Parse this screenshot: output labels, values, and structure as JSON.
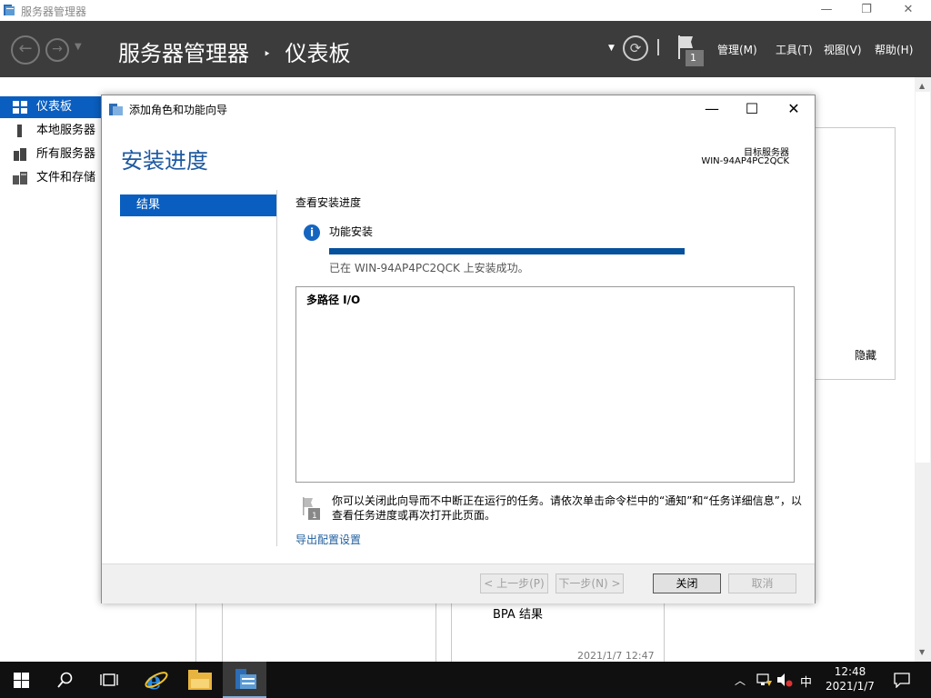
{
  "window": {
    "title": "服务器管理器",
    "minimize": "—",
    "restore": "❐",
    "close": "✕"
  },
  "header": {
    "breadcrumb_app": "服务器管理器",
    "breadcrumb_sep": "‣",
    "breadcrumb_page": "仪表板",
    "notification_count": "1",
    "menus": [
      "管理(M)",
      "工具(T)",
      "视图(V)",
      "帮助(H)"
    ]
  },
  "sidebar": {
    "items": [
      {
        "label": "仪表板",
        "icon": "dashboard-icon",
        "selected": true
      },
      {
        "label": "本地服务器",
        "icon": "server-icon",
        "selected": false
      },
      {
        "label": "所有服务器",
        "icon": "servers-icon",
        "selected": false
      },
      {
        "label": "文件和存储",
        "icon": "storage-icon",
        "selected": false
      }
    ]
  },
  "dashboard": {
    "hide_label": "隐藏",
    "bpa_label": "BPA 结果",
    "timestamp": "2021/1/7 12:47"
  },
  "dialog": {
    "title": "添加角色和功能向导",
    "heading": "安装进度",
    "target_label": "目标服务器",
    "target_value": "WIN-94AP4PC2QCK",
    "steps": [
      {
        "label": "结果",
        "selected": true
      }
    ],
    "subheading": "查看安装进度",
    "feature_title": "功能安装",
    "progress": 1.0,
    "status_text": "已在 WIN-94AP4PC2QCK 上安装成功。",
    "installed_items": [
      "多路径 I/O"
    ],
    "note": "你可以关闭此向导而不中断正在运行的任务。请依次单击命令栏中的“通知”和“任务详细信息”，以查看任务进度或再次打开此页面。",
    "export_link": "导出配置设置",
    "buttons": {
      "prev": "< 上一步(P)",
      "next": "下一步(N) >",
      "close": "关闭",
      "cancel": "取消"
    }
  },
  "taskbar": {
    "ime": "中",
    "time": "12:48",
    "date": "2021/1/7"
  },
  "colors": {
    "header_bg": "#3c3c3c",
    "accent": "#0a5ebf",
    "progress": "#06519c",
    "heading": "#1e5aa0",
    "taskbar_bg": "#101010"
  }
}
